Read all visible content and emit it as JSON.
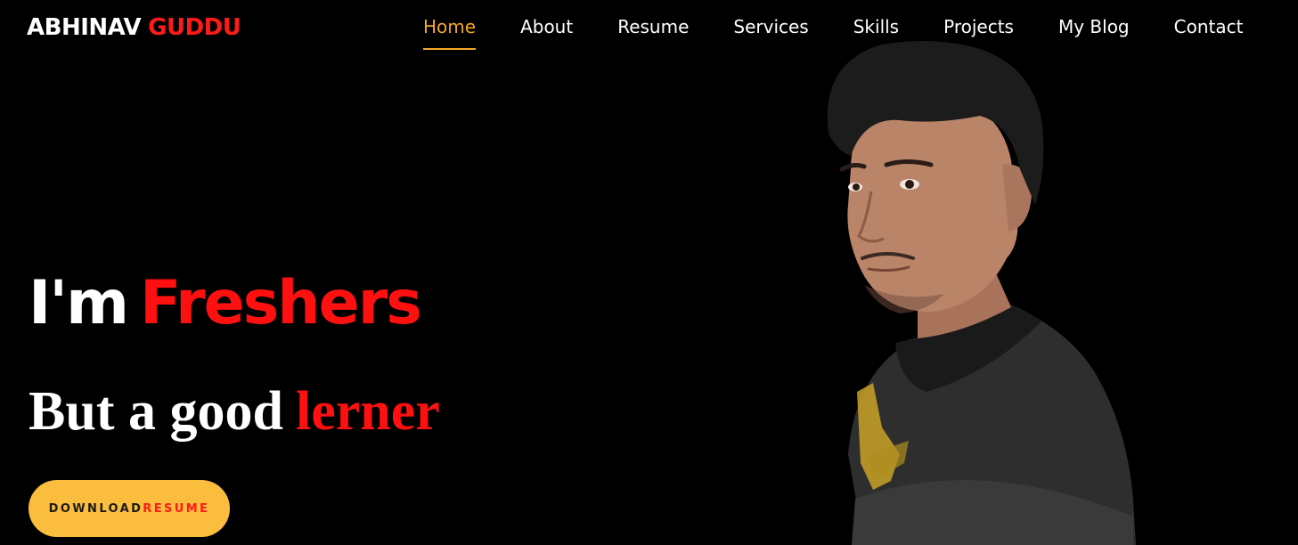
{
  "header": {
    "logo_first": "ABHINAV",
    "logo_last": "GUDDU"
  },
  "nav": {
    "items": [
      {
        "label": "Home",
        "active": true
      },
      {
        "label": "About"
      },
      {
        "label": "Resume"
      },
      {
        "label": "Services"
      },
      {
        "label": "Skills"
      },
      {
        "label": "Projects"
      },
      {
        "label": "My Blog"
      },
      {
        "label": "Contact"
      }
    ]
  },
  "hero": {
    "title_lead": "I'm",
    "title_accent": "Freshers",
    "subtitle_lead": "But a good",
    "subtitle_accent": "lerner",
    "button_part1": "DOWNLOAD",
    "button_part2": "RESUME"
  },
  "colors": {
    "background": "#000000",
    "accent_red": "#ff1010",
    "nav_active": "#f3a629",
    "button_bg": "#fbbd3d"
  },
  "icons": {
    "portrait": "person-portrait-photo"
  }
}
